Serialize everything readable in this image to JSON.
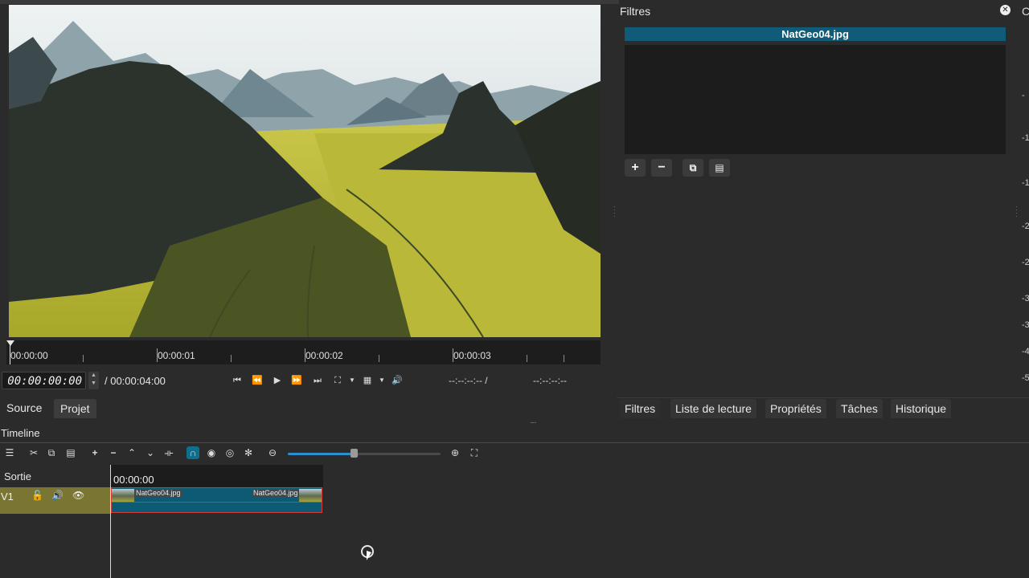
{
  "preview": {
    "image_name": "landscape-karst-mountains-rapeseed-fields"
  },
  "ruler": {
    "labels": [
      "00:00:00",
      "00:00:01",
      "00:00:02",
      "00:00:03"
    ]
  },
  "transport": {
    "timecode": "00:00:00:00",
    "total": "/ 00:00:04:00",
    "in_point": "--:--:--:-- /",
    "out_point": "--:--:--:--",
    "icons": [
      "skip-start-icon",
      "rewind-icon",
      "play-icon",
      "fast-forward-icon",
      "skip-end-icon",
      "zoom-fit-icon",
      "chevron-down-icon",
      "grid-icon",
      "chevron-down-icon",
      "volume-icon"
    ]
  },
  "left_tabs": {
    "source": "Source",
    "projet": "Projet"
  },
  "filters": {
    "title": "Filtres",
    "clip_name": "NatGeo04.jpg",
    "side_letter": "C",
    "meter_labels": [
      "-",
      "-1",
      "-1",
      "-2",
      "-2",
      "-3",
      "-3",
      "-4",
      "-5"
    ]
  },
  "right_tabs": [
    "Filtres",
    "Liste de lecture",
    "Propriétés",
    "Tâches",
    "Historique"
  ],
  "timeline": {
    "title": "Timeline",
    "output_track": "Sortie",
    "track_name": "V1",
    "time": "00:00:00",
    "clip": {
      "name_left": "NatGeo04.jpg",
      "name_right": "NatGeo04.jpg"
    }
  },
  "colors": {
    "accent": "#0f5b78",
    "track_head": "#7a7533",
    "clip_border": "#d43a3a"
  }
}
